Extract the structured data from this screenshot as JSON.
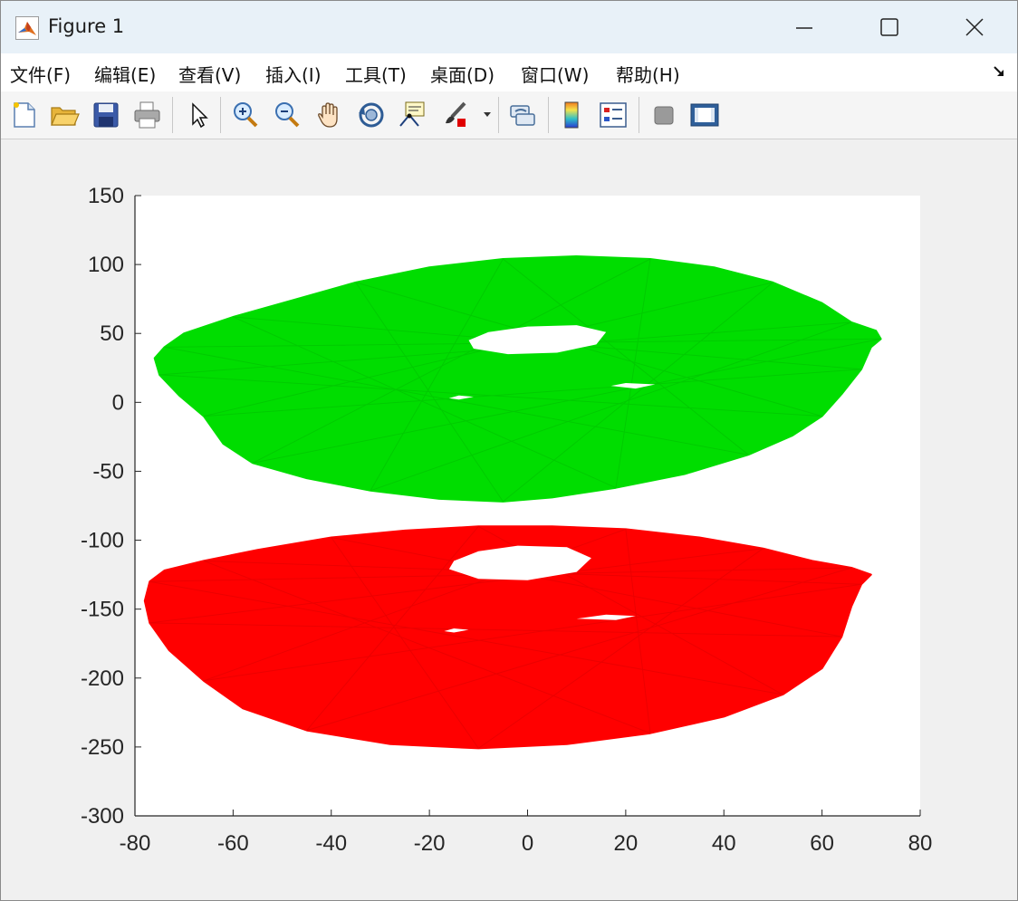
{
  "window": {
    "title": "Figure 1",
    "controls": [
      "minimize",
      "maximize",
      "close"
    ]
  },
  "menu": {
    "items": [
      "文件(F)",
      "编辑(E)",
      "查看(V)",
      "插入(I)",
      "工具(T)",
      "桌面(D)",
      "窗口(W)",
      "帮助(H)"
    ]
  },
  "toolbar": {
    "buttons": [
      {
        "name": "new-figure",
        "icon": "new-document-icon"
      },
      {
        "name": "open-file",
        "icon": "folder-open-icon"
      },
      {
        "name": "save-figure",
        "icon": "floppy-disk-icon"
      },
      {
        "name": "print-figure",
        "icon": "printer-icon"
      },
      {
        "name": "edit-plot",
        "icon": "pointer-arrow-icon"
      },
      {
        "name": "zoom-in",
        "icon": "zoom-in-icon"
      },
      {
        "name": "zoom-out",
        "icon": "zoom-out-icon"
      },
      {
        "name": "pan",
        "icon": "hand-icon"
      },
      {
        "name": "rotate-3d",
        "icon": "rotate-icon"
      },
      {
        "name": "data-cursor",
        "icon": "data-tip-icon"
      },
      {
        "name": "brush",
        "icon": "brush-icon"
      },
      {
        "name": "link-plot",
        "icon": "link-icon"
      },
      {
        "name": "insert-colorbar",
        "icon": "colorbar-icon"
      },
      {
        "name": "insert-legend",
        "icon": "legend-icon"
      },
      {
        "name": "hide-plot-tools",
        "icon": "hide-tools-icon"
      },
      {
        "name": "show-plot-tools",
        "icon": "show-tools-icon"
      }
    ]
  },
  "chart_data": {
    "type": "area",
    "title": "",
    "xlabel": "",
    "ylabel": "",
    "xlim": [
      -80,
      80
    ],
    "ylim": [
      -300,
      150
    ],
    "xticks": [
      -80,
      -60,
      -40,
      -20,
      0,
      20,
      40,
      60,
      80
    ],
    "yticks": [
      150,
      100,
      50,
      0,
      -50,
      -100,
      -150,
      -200,
      -250,
      -300
    ],
    "grid": false,
    "series": [
      {
        "color": "#00dd00",
        "outline": [
          [
            -74,
            40
          ],
          [
            -70,
            50
          ],
          [
            -60,
            62
          ],
          [
            -48,
            74
          ],
          [
            -35,
            87
          ],
          [
            -20,
            98
          ],
          [
            -5,
            104
          ],
          [
            10,
            106
          ],
          [
            25,
            104
          ],
          [
            38,
            98
          ],
          [
            50,
            87
          ],
          [
            60,
            72
          ],
          [
            66,
            58
          ],
          [
            71,
            52
          ],
          [
            72,
            46
          ],
          [
            70,
            40
          ],
          [
            68,
            24
          ],
          [
            64,
            6
          ],
          [
            60,
            -10
          ],
          [
            54,
            -24
          ],
          [
            45,
            -38
          ],
          [
            32,
            -52
          ],
          [
            18,
            -62
          ],
          [
            5,
            -69
          ],
          [
            -5,
            -72
          ],
          [
            -18,
            -70
          ],
          [
            -32,
            -64
          ],
          [
            -45,
            -55
          ],
          [
            -56,
            -44
          ],
          [
            -62,
            -30
          ],
          [
            -66,
            -10
          ],
          [
            -71,
            5
          ],
          [
            -75,
            20
          ],
          [
            -76,
            32
          ]
        ],
        "holes": [
          [
            [
              -12,
              45
            ],
            [
              -8,
              51
            ],
            [
              0,
              55
            ],
            [
              10,
              56
            ],
            [
              16,
              51
            ],
            [
              14,
              42
            ],
            [
              6,
              36
            ],
            [
              -4,
              35
            ],
            [
              -11,
              39
            ]
          ],
          [
            [
              17,
              12
            ],
            [
              20,
              14
            ],
            [
              26,
              13
            ],
            [
              22,
              10
            ]
          ],
          [
            [
              -16,
              3
            ],
            [
              -14,
              5
            ],
            [
              -11,
              4
            ],
            [
              -14,
              2
            ]
          ]
        ]
      },
      {
        "color": "#ff0000",
        "outline": [
          [
            -77,
            -130
          ],
          [
            -74,
            -122
          ],
          [
            -66,
            -115
          ],
          [
            -55,
            -107
          ],
          [
            -40,
            -98
          ],
          [
            -25,
            -93
          ],
          [
            -10,
            -90
          ],
          [
            5,
            -90
          ],
          [
            20,
            -92
          ],
          [
            35,
            -98
          ],
          [
            48,
            -106
          ],
          [
            58,
            -115
          ],
          [
            66,
            -120
          ],
          [
            70,
            -125
          ],
          [
            68,
            -132
          ],
          [
            66,
            -148
          ],
          [
            64,
            -170
          ],
          [
            60,
            -193
          ],
          [
            52,
            -212
          ],
          [
            40,
            -228
          ],
          [
            25,
            -240
          ],
          [
            8,
            -248
          ],
          [
            -10,
            -251
          ],
          [
            -28,
            -248
          ],
          [
            -45,
            -238
          ],
          [
            -58,
            -222
          ],
          [
            -66,
            -202
          ],
          [
            -73,
            -180
          ],
          [
            -77,
            -160
          ],
          [
            -78,
            -144
          ]
        ],
        "holes": [
          [
            [
              -15,
              -115
            ],
            [
              -10,
              -108
            ],
            [
              -2,
              -104
            ],
            [
              8,
              -105
            ],
            [
              13,
              -113
            ],
            [
              10,
              -123
            ],
            [
              0,
              -129
            ],
            [
              -10,
              -128
            ],
            [
              -16,
              -121
            ]
          ],
          [
            [
              10,
              -157
            ],
            [
              16,
              -154
            ],
            [
              22,
              -155
            ],
            [
              18,
              -158
            ]
          ],
          [
            [
              -17,
              -166
            ],
            [
              -15,
              -164
            ],
            [
              -12,
              -165
            ],
            [
              -15,
              -167
            ]
          ]
        ]
      }
    ]
  }
}
